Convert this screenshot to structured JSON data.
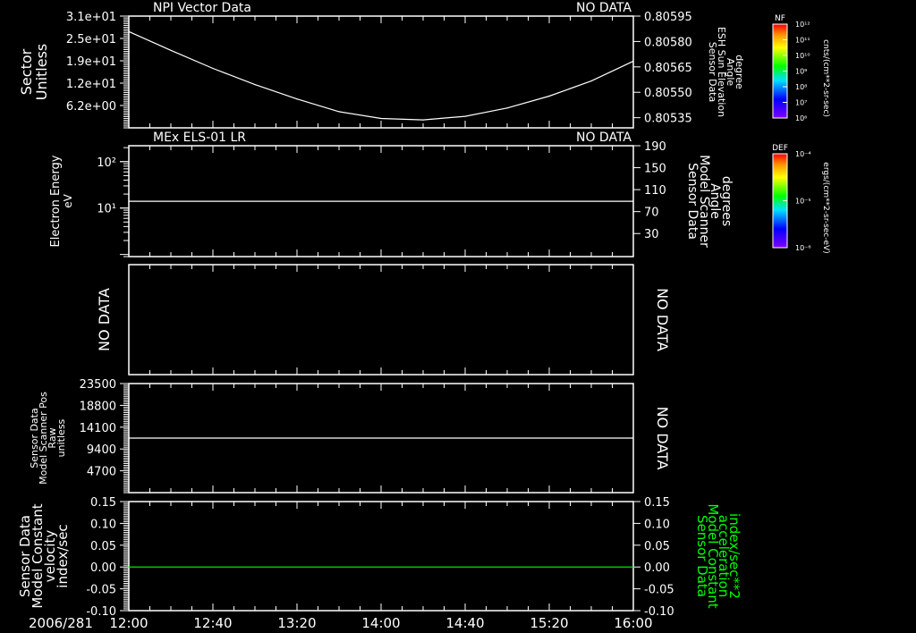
{
  "colors": {
    "background": "#000000",
    "axes": "#ffffff",
    "green": "#00ff00"
  },
  "time_axis": {
    "date_label": "2006/281",
    "range": [
      "12:00",
      "16:00"
    ],
    "ticks": [
      "12:00",
      "12:40",
      "13:20",
      "14:00",
      "14:40",
      "15:20",
      "16:00"
    ]
  },
  "chart_data": [
    {
      "type": "line",
      "title": "NPI Vector Data",
      "status": "NO DATA",
      "ylabel": [
        "Sector",
        "Unitless"
      ],
      "ylim": [
        0,
        31
      ],
      "yticks": [
        "3.1e+01",
        "2.5e+01",
        "1.9e+01",
        "1.2e+01",
        "6.2e+00"
      ],
      "ytick_values": [
        31,
        24.8,
        18.6,
        12.4,
        6.2
      ],
      "y2label": [
        "Sensor Data",
        "ESH Sun Elevation",
        "Angle",
        "degree"
      ],
      "y2lim": [
        0.80529,
        0.80595
      ],
      "y2ticks": [
        "0.80595",
        "0.80580",
        "0.80565",
        "0.80550",
        "0.80535"
      ],
      "y2tick_values": [
        0.80595,
        0.8058,
        0.80565,
        0.8055,
        0.80535
      ],
      "series": [
        {
          "color": "#ffffff",
          "x": [
            "12:00",
            "12:20",
            "12:40",
            "13:00",
            "13:20",
            "13:40",
            "14:00",
            "14:20",
            "14:40",
            "15:00",
            "15:20",
            "15:40",
            "16:00"
          ],
          "y": [
            26.7,
            21.5,
            16.5,
            12.0,
            8.0,
            4.5,
            2.6,
            2.2,
            3.2,
            5.5,
            8.8,
            13.0,
            18.5
          ]
        }
      ]
    },
    {
      "type": "line",
      "title": "MEx ELS-01 LR",
      "status": "NO DATA",
      "ylabel": [
        "Electron Energy",
        "eV"
      ],
      "yscale": "log",
      "ylim": [
        0.9,
        220
      ],
      "yticks": [
        "10²",
        "10¹"
      ],
      "ytick_values": [
        100,
        10
      ],
      "y2label": [
        "Sensor Data",
        "Model Scanner",
        "Angle",
        "degrees"
      ],
      "y2lim": [
        -12,
        190
      ],
      "y2ticks": [
        "190",
        "150",
        "110",
        "70",
        "30"
      ],
      "y2tick_values": [
        190,
        150,
        110,
        70,
        30
      ],
      "series": [
        {
          "color": "#ffffff",
          "x": [
            "12:00",
            "16:00"
          ],
          "y": [
            14,
            14
          ]
        }
      ]
    },
    {
      "type": "line",
      "title": "",
      "ylabel": [
        "NO DATA"
      ],
      "y2label": [
        "NO DATA"
      ],
      "series": []
    },
    {
      "type": "line",
      "title": "",
      "ylabel": [
        "Sensor Data",
        "Model Scanner Pos",
        "Raw",
        "unitless"
      ],
      "ylim": [
        0,
        23500
      ],
      "yticks": [
        "23500",
        "18800",
        "14100",
        "9400",
        "4700"
      ],
      "ytick_values": [
        23500,
        18800,
        14100,
        9400,
        4700
      ],
      "y2label": [
        "NO DATA"
      ],
      "series": [
        {
          "color": "#ffffff",
          "x": [
            "12:00",
            "16:00"
          ],
          "y": [
            11750,
            11750
          ]
        }
      ]
    },
    {
      "type": "line",
      "title": "",
      "ylabel": [
        "Sensor Data",
        "Model Constant",
        "velocity",
        "index/sec"
      ],
      "ylim": [
        -0.1,
        0.15
      ],
      "yticks": [
        "0.15",
        "0.10",
        "0.05",
        "0.00",
        "-0.05",
        "-0.10"
      ],
      "ytick_values": [
        0.15,
        0.1,
        0.05,
        0.0,
        -0.05,
        -0.1
      ],
      "y2label": [
        "Sensor Data",
        "Model Constant",
        "acceleration",
        "index/sec**2"
      ],
      "y2label_color": "#00ff00",
      "y2lim": [
        -0.1,
        0.15
      ],
      "y2ticks": [
        "0.15",
        "0.10",
        "0.05",
        "0.00",
        "-0.05",
        "-0.10"
      ],
      "y2tick_values": [
        0.15,
        0.1,
        0.05,
        0.0,
        -0.05,
        -0.1
      ],
      "series": [
        {
          "color": "#00ff00",
          "x": [
            "12:00",
            "16:00"
          ],
          "y": [
            0.0,
            0.0
          ]
        }
      ]
    }
  ],
  "colorbars": [
    {
      "title": "NF",
      "ticks": [
        "10¹²",
        "10¹¹",
        "10¹⁰",
        "10⁹",
        "10⁸",
        "10⁷",
        "10⁶"
      ],
      "unit": "cnts/(cm**2-sr-sec)"
    },
    {
      "title": "DEF",
      "ticks": [
        "10⁻⁴",
        "10⁻⁵",
        "10⁻⁶"
      ],
      "unit": "ergs/(cm**2-sr-sec-eV)"
    }
  ]
}
